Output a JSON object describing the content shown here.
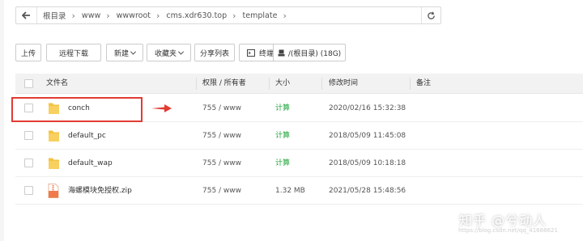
{
  "breadcrumb": {
    "items": [
      "根目录",
      "www",
      "wwwroot",
      "cms.xdr630.top",
      "template"
    ]
  },
  "toolbar": {
    "upload": "上传",
    "remote_download": "远程下载",
    "new": "新建",
    "favorites": "收藏夹",
    "share_list": "分享列表",
    "terminal": "终端",
    "disk": "/(根目录) (18G)"
  },
  "table": {
    "headers": {
      "name": "文件名",
      "perm": "权限 / 所有者",
      "size": "大小",
      "mtime": "修改时间",
      "note": "备注"
    },
    "rows": [
      {
        "name": "conch",
        "perm": "755 / www",
        "size": "计算",
        "mtime": "2020/02/16 15:32:38",
        "type": "folder"
      },
      {
        "name": "default_pc",
        "perm": "755 / www",
        "size": "计算",
        "mtime": "2018/05/09 11:45:08",
        "type": "folder"
      },
      {
        "name": "default_wap",
        "perm": "755 / www",
        "size": "计算",
        "mtime": "2018/05/09 10:18:18",
        "type": "folder"
      },
      {
        "name": "海螺模块免授权.zip",
        "perm": "755 / www",
        "size": "1.32 MB",
        "mtime": "2021/05/28 15:48:56",
        "type": "zip"
      }
    ]
  },
  "watermark": {
    "main": "知乎 @兮动人",
    "sub": "https://blog.csdn.net/qq_41688621"
  },
  "colors": {
    "highlight": "#e23b32",
    "calc_green": "#20a53a",
    "folder_yellow": "#f5c242"
  }
}
